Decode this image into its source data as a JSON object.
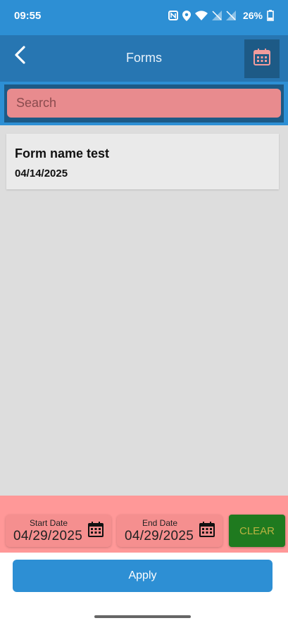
{
  "status_bar": {
    "time": "09:55",
    "battery": "26%",
    "icons": [
      "nfc-icon",
      "location-icon",
      "wifi-icon",
      "no-signal-icon",
      "no-signal-icon",
      "battery-icon"
    ]
  },
  "header": {
    "title": "Forms",
    "back_icon": "chevron-left-icon",
    "calendar_icon": "calendar-icon"
  },
  "search": {
    "placeholder": "Search",
    "value": ""
  },
  "forms": [
    {
      "name": "Form name test",
      "date": "04/14/2025"
    }
  ],
  "filter": {
    "start_label": "Start Date",
    "start_value": "04/29/2025",
    "end_label": "End Date",
    "end_value": "04/29/2025",
    "clear_label": "CLEAR"
  },
  "apply_label": "Apply",
  "colors": {
    "status_bar": "#2d8fd4",
    "header": "#2776b2",
    "accent_dark": "#1d5a86",
    "search_bg": "#e88b8e",
    "filter_bar": "#ff9898",
    "clear_bg": "#1f7a1f",
    "apply_bg": "#2d8fd4"
  }
}
